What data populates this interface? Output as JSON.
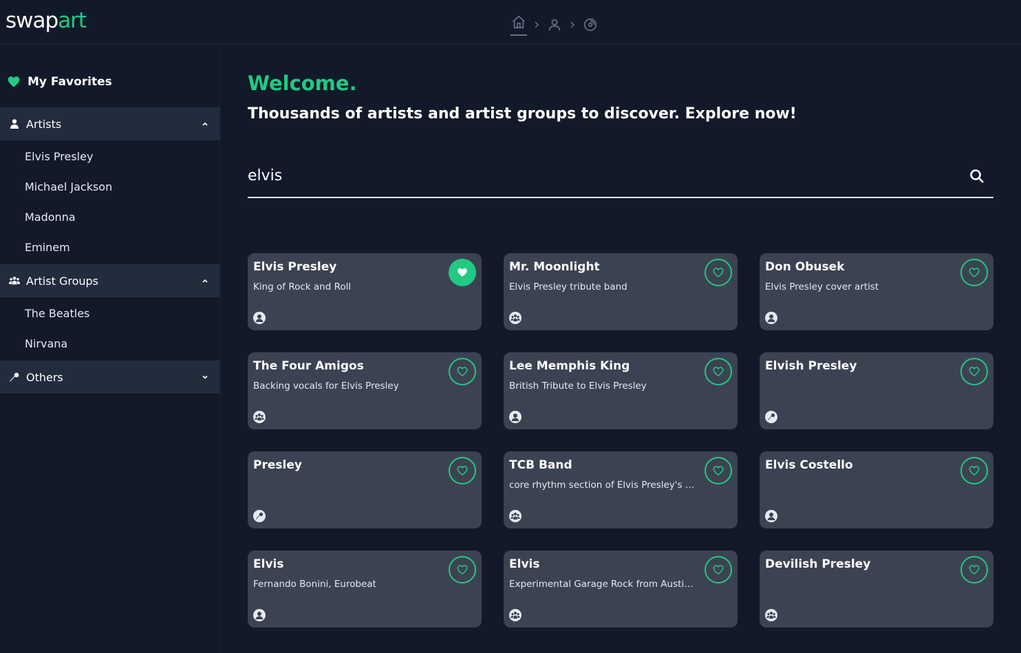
{
  "app": {
    "logo_prefix": "swap",
    "logo_accent": "art",
    "accent_color": "#22c983"
  },
  "breadcrumb": [
    {
      "icon": "home-icon",
      "active": true
    },
    {
      "icon": "user-icon",
      "active": false
    },
    {
      "icon": "disc-icon",
      "active": false
    }
  ],
  "sidebar": {
    "favorites_label": "My Favorites",
    "artists": {
      "label": "Artists",
      "expanded": true,
      "items": [
        "Elvis Presley",
        "Michael Jackson",
        "Madonna",
        "Eminem"
      ]
    },
    "groups": {
      "label": "Artist Groups",
      "expanded": true,
      "items": [
        "The Beatles",
        "Nirvana"
      ]
    },
    "others": {
      "label": "Others",
      "expanded": false
    }
  },
  "main": {
    "welcome": "Welcome.",
    "subtitle": "Thousands of artists and artist groups to discover. Explore now!",
    "search_value": "elvis"
  },
  "results": [
    {
      "name": "Elvis Presley",
      "desc": "King of Rock and Roll",
      "type": "person",
      "favorite": true
    },
    {
      "name": "Mr. Moonlight",
      "desc": "Elvis Presley tribute band",
      "type": "group",
      "favorite": false
    },
    {
      "name": "Don Obusek",
      "desc": "Elvis Presley cover artist",
      "type": "person",
      "favorite": false
    },
    {
      "name": "The Four Amigos",
      "desc": "Backing vocals for Elvis Presley",
      "type": "group",
      "favorite": false
    },
    {
      "name": "Lee Memphis King",
      "desc": "British Tribute to Elvis Presley",
      "type": "person",
      "favorite": false
    },
    {
      "name": "Elvish Presley",
      "desc": "",
      "type": "other",
      "favorite": false
    },
    {
      "name": "Presley",
      "desc": "",
      "type": "other",
      "favorite": false
    },
    {
      "name": "TCB Band",
      "desc": "core rhythm section of Elvis Presley's band",
      "type": "group",
      "favorite": false
    },
    {
      "name": "Elvis Costello",
      "desc": "",
      "type": "person",
      "favorite": false
    },
    {
      "name": "Elvis",
      "desc": "Fernando Bonini, Eurobeat",
      "type": "person",
      "favorite": false
    },
    {
      "name": "Elvis",
      "desc": "Experimental Garage Rock from Austin,…",
      "type": "group",
      "favorite": false
    },
    {
      "name": "Devilish Presley",
      "desc": "",
      "type": "group",
      "favorite": false
    }
  ]
}
